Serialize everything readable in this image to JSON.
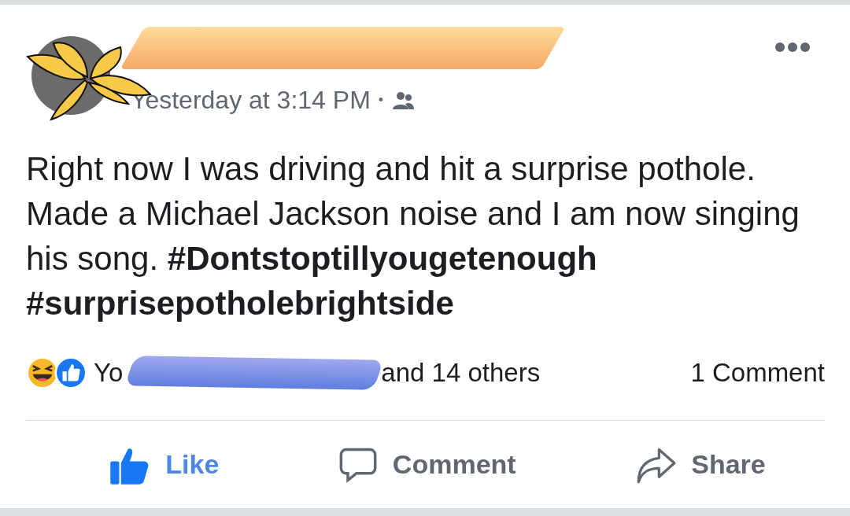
{
  "post": {
    "timestamp": "Yesterday at 3:14 PM",
    "separator": "•",
    "audience": {
      "kind": "friends"
    },
    "body": "Right now I was driving and hit a surprise pothole. Made a Michael Jackson noise and I am now singing his song. **#Dontstoptillyougetenough** **#surprisepotholebrightside**"
  },
  "reactions": {
    "types": [
      {
        "kind": "haha"
      },
      {
        "kind": "like"
      }
    ],
    "names_start": "Yo",
    "names_end": "and 14 others",
    "comments": "1 Comment"
  },
  "actions": [
    {
      "kind": "like",
      "label": "Like",
      "selected": true
    },
    {
      "kind": "comment",
      "label": "Comment",
      "selected": false
    },
    {
      "kind": "share",
      "label": "Share",
      "selected": false
    }
  ]
}
